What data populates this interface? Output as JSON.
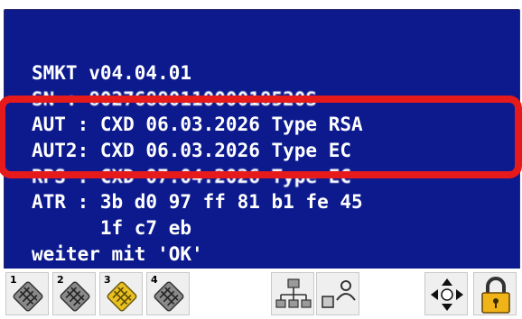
{
  "display": {
    "lines": [
      "SMKT v04.04.01",
      "SN : 8027688011000018520S",
      "AUT : CXD 06.03.2026 Type RSA",
      "AUT2: CXD 06.03.2026 Type EC",
      "RPS : CXD 07.04.2026 Type EC",
      "ATR : 3b d0 97 ff 81 b1 fe 45",
      "      1f c7 eb",
      "weiter mit 'OK'"
    ]
  },
  "toolbar": {
    "slots": [
      {
        "number": "1",
        "icon": "smartcard-slot-icon"
      },
      {
        "number": "2",
        "icon": "smartcard-slot-icon"
      },
      {
        "number": "3",
        "icon": "smartcard-slot-icon"
      },
      {
        "number": "4",
        "icon": "smartcard-slot-icon"
      }
    ],
    "network_icon": "network-icon",
    "user_icon": "user-card-icon",
    "navigation_icon": "navigation-arrows-icon",
    "lock_icon": "lock-icon"
  },
  "colors": {
    "screen_background": "#0c1a8e",
    "text": "#ffffff",
    "highlight": "#e61a1a",
    "slot_active": "#e8c020"
  }
}
